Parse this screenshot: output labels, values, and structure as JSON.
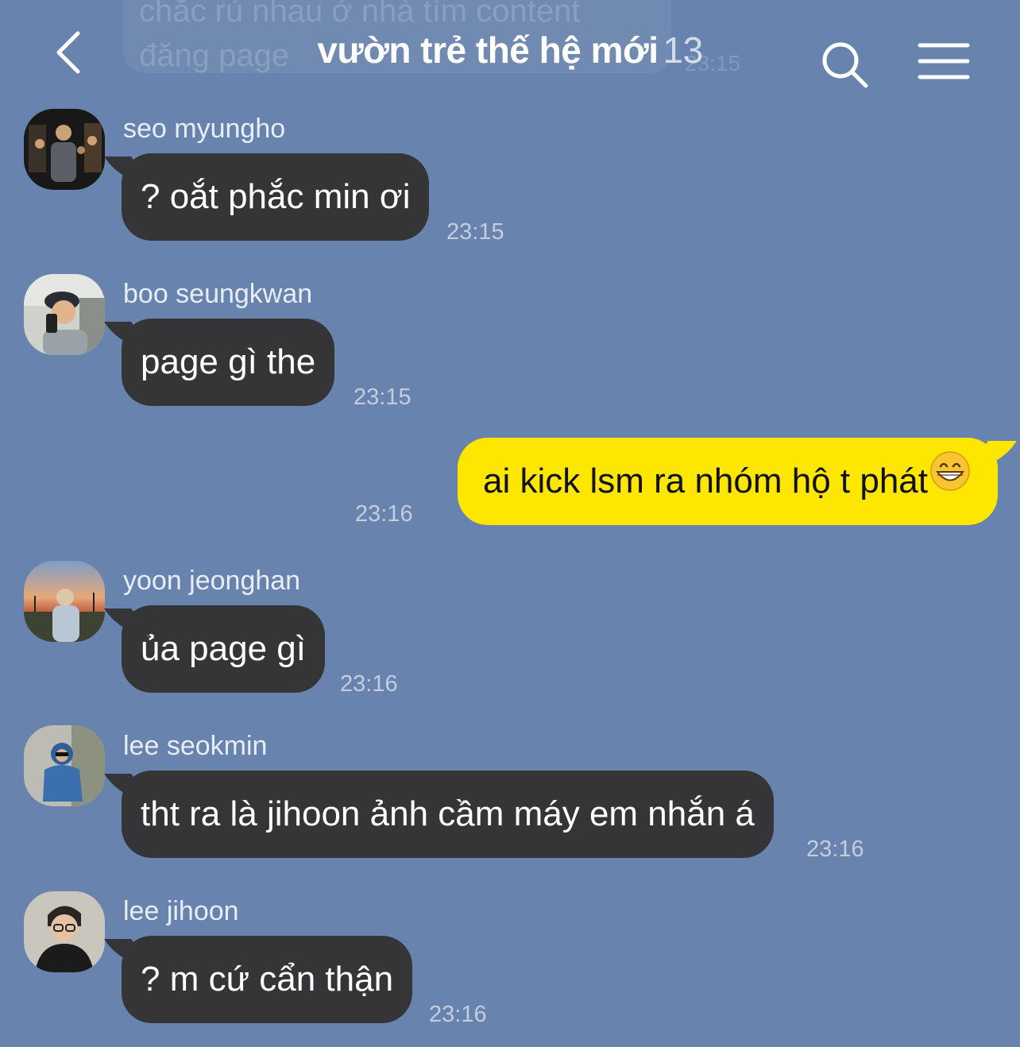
{
  "header": {
    "title": "vườn trẻ thế hệ mới",
    "member_count": "13"
  },
  "ghost_message": {
    "line1": "chắc rủ nhau ở nhà tìm content",
    "line2": "đăng page",
    "time": "23:15"
  },
  "messages": [
    {
      "type": "incoming",
      "sender": "seo myungho",
      "text": "? oắt phắc min ơi",
      "time": "23:15"
    },
    {
      "type": "incoming",
      "sender": "boo seungkwan",
      "text": "page gì the",
      "time": "23:15"
    },
    {
      "type": "outgoing",
      "text": "ai kick lsm ra nhóm hộ t phát",
      "emoji": "grinning-face-emoji",
      "time": "23:16"
    },
    {
      "type": "incoming",
      "sender": "yoon jeonghan",
      "text": "ủa page gì",
      "time": "23:16"
    },
    {
      "type": "incoming",
      "sender": "lee seokmin",
      "text": "tht ra là jihoon ảnh cầm máy em nhắn á",
      "time": "23:16"
    },
    {
      "type": "incoming",
      "sender": "lee jihoon",
      "text": "? m cứ cẩn thận",
      "time": "23:16"
    }
  ],
  "icons": {
    "back": "chevron-left-icon",
    "search": "search-icon",
    "menu": "hamburger-menu-icon"
  },
  "colors": {
    "background": "#6883ad",
    "incoming_bubble": "#353537",
    "outgoing_bubble": "#fde600"
  }
}
